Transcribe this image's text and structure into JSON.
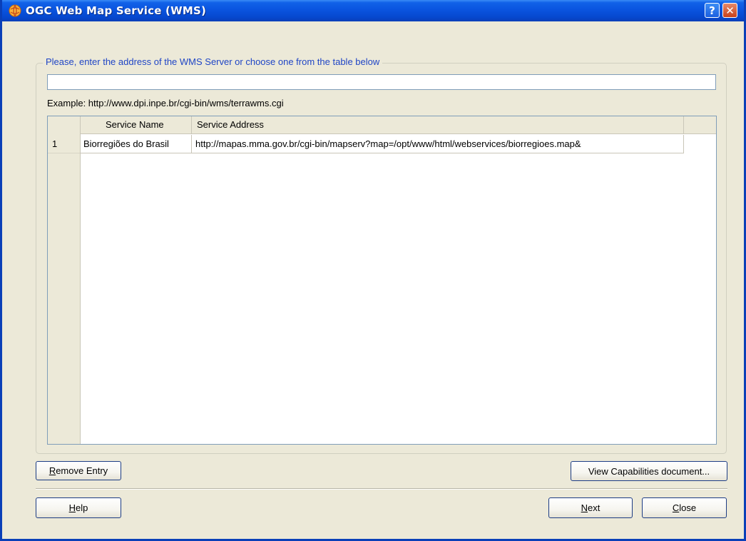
{
  "window": {
    "title": "OGC Web Map Service (WMS)",
    "help_glyph": "?",
    "close_glyph": "✕"
  },
  "group": {
    "legend": "Please, enter the address of the WMS Server or choose one from the table below",
    "url_value": "",
    "example": "Example: http://www.dpi.inpe.br/cgi-bin/wms/terrawms.cgi"
  },
  "table": {
    "columns": [
      "Service Name",
      "Service Address"
    ],
    "rows": [
      {
        "num": "1",
        "name": "Biorregiões do Brasil",
        "address": "http://mapas.mma.gov.br/cgi-bin/mapserv?map=/opt/www/html/webservices/biorregioes.map&"
      }
    ]
  },
  "buttons": {
    "remove_mn": "R",
    "remove_rest": "emove Entry",
    "view_capabilities": "View Capabilities document...",
    "help_mn": "H",
    "help_rest": "elp",
    "next_mn": "N",
    "next_rest": "ext",
    "close_mn": "C",
    "close_rest": "lose"
  },
  "colors": {
    "titlebar": "#0a54df",
    "legend_text": "#1f45c6",
    "dialog_bg": "#ece9d8"
  }
}
